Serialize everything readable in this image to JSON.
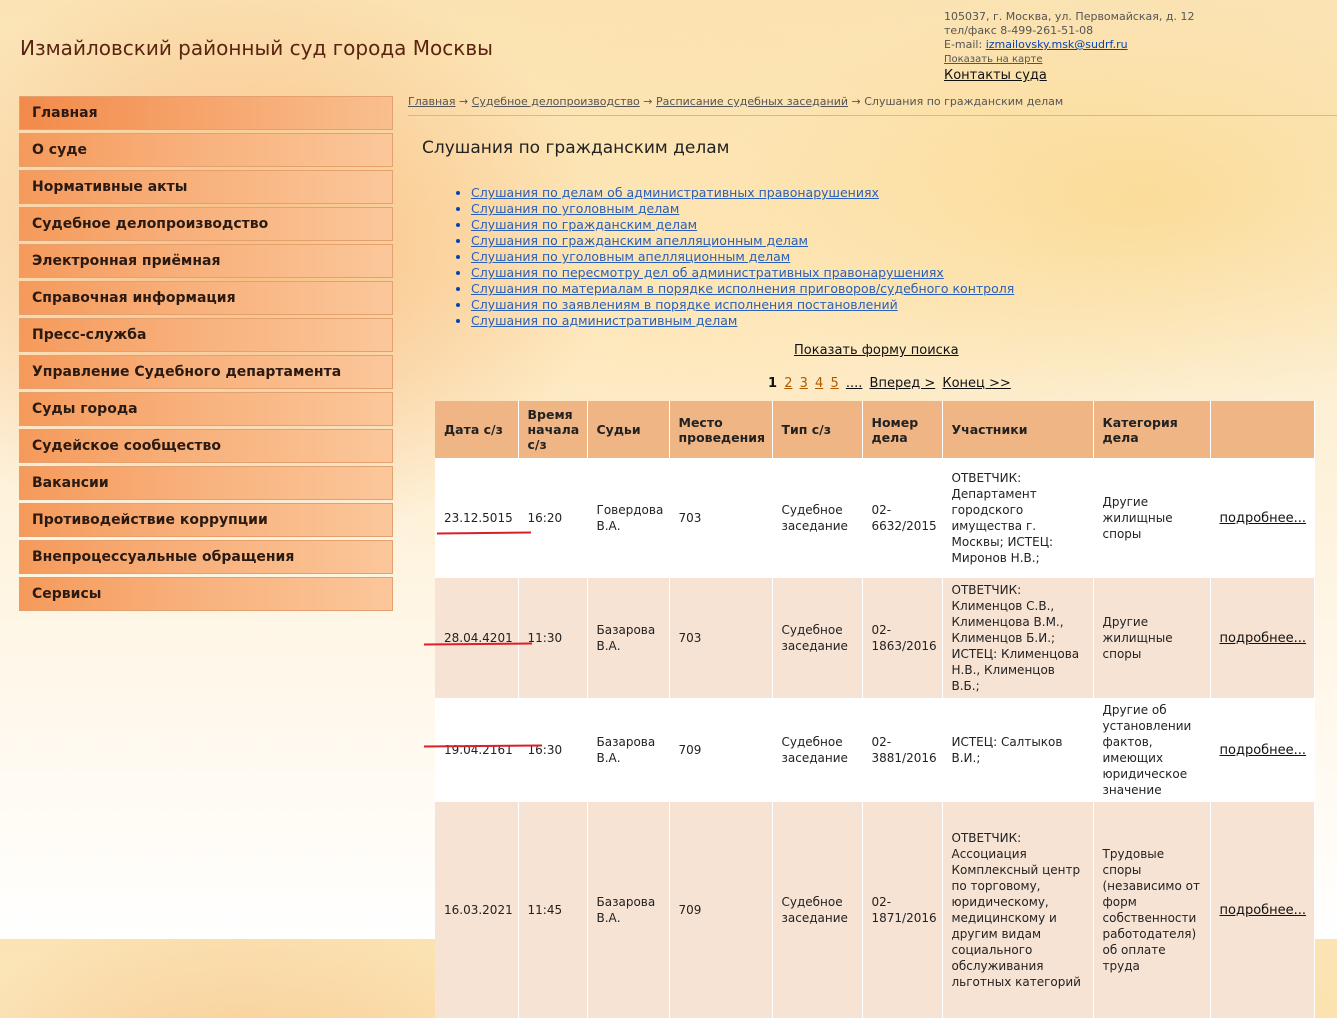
{
  "header": {
    "title": "Измайловский районный суд города Москвы",
    "address": "105037, г. Москва, ул. Первомайская, д. 12",
    "phone": "тел/факс 8-499-261-51-08",
    "email_label": "E-mail:",
    "email": "izmailovsky.msk@sudrf.ru",
    "map_link": "Показать на карте",
    "contacts_link": "Контакты суда"
  },
  "sidebar": {
    "items": [
      {
        "label": "Главная"
      },
      {
        "label": "О суде"
      },
      {
        "label": "Нормативные акты"
      },
      {
        "label": "Судебное делопроизводство"
      },
      {
        "label": "Электронная приёмная"
      },
      {
        "label": "Справочная информация"
      },
      {
        "label": "Пресс-служба"
      },
      {
        "label": "Управление Судебного департамента"
      },
      {
        "label": "Суды города"
      },
      {
        "label": "Судейское сообщество"
      },
      {
        "label": "Вакансии"
      },
      {
        "label": "Противодействие коррупции"
      },
      {
        "label": "Внепроцессуальные обращения"
      },
      {
        "label": "Сервисы"
      }
    ]
  },
  "breadcrumb": {
    "items": [
      "Главная",
      "Судебное делопроизводство",
      "Расписание судебных заседаний"
    ],
    "separator": "→",
    "current": "Слушания по гражданским делам"
  },
  "main": {
    "title": "Слушания по гражданским делам",
    "links": [
      "Слушания по делам об административных правонарушениях",
      "Слушания по уголовным делам",
      "Слушания по гражданским делам",
      "Слушания по гражданским апелляционным делам",
      "Слушания по уголовным апелляционным делам",
      "Слушания по пересмотру дел об административных правонарушениях",
      "Слушания по материалам в порядке исполнения приговоров/судебного контроля",
      "Слушания по заявлениям в порядке исполнения постановлений",
      "Слушания по административным делам"
    ],
    "search_form_link": "Показать форму поиска",
    "pager": {
      "current": "1",
      "pages": [
        "2",
        "3",
        "4",
        "5"
      ],
      "ellipsis": "....",
      "next": "Вперед >",
      "last": "Конец >>"
    }
  },
  "table": {
    "headers": [
      "Дата с/з",
      "Время начала с/з",
      "Судьи",
      "Место проведения",
      "Тип с/з",
      "Номер дела",
      "Участники",
      "Категория дела",
      ""
    ],
    "rows": [
      {
        "date": "23.12.5015",
        "time": "16:20",
        "judge": "Говердова В.А.",
        "place": "703",
        "type": "Судебное заседание",
        "case": "02-6632/2015",
        "participants": "ОТВЕТЧИК: Департамент городского имущества г. Москвы; ИСТЕЦ: Миронов Н.В.;",
        "category": "Другие жилищные споры",
        "more": "подробнее..."
      },
      {
        "date": "28.04.4201",
        "time": "11:30",
        "judge": "Базарова В.А.",
        "place": "703",
        "type": "Судебное заседание",
        "case": "02-1863/2016",
        "participants": "ОТВЕТЧИК: Клименцов С.В., Клименцова В.М., Клименцов Б.И.; ИСТЕЦ: Клименцова Н.В., Клименцов В.Б.;",
        "category": "Другие жилищные споры",
        "more": "подробнее..."
      },
      {
        "date": "19.04.2161",
        "time": "16:30",
        "judge": "Базарова В.А.",
        "place": "709",
        "type": "Судебное заседание",
        "case": "02-3881/2016",
        "participants": "ИСТЕЦ: Салтыков В.И.;",
        "category": "Другие об установлении фактов, имеющих юридическое значение",
        "more": "подробнее..."
      },
      {
        "date": "16.03.2021",
        "time": "11:45",
        "judge": "Базарова В.А.",
        "place": "709",
        "type": "Судебное заседание",
        "case": "02-1871/2016",
        "participants": "ОТВЕТЧИК: Ассоциация Комплексный центр по торговому, юридическому, медицинскому и другим видам социального обслуживания льготных категорий",
        "category": "Трудовые споры (независимо от форм собственности работодателя) об оплате труда",
        "more": "подробнее..."
      }
    ]
  },
  "colors": {
    "annotation_underline": "#d9202a",
    "table_header_bg": "#efb584",
    "nav_item_bg": "#f59a5b"
  }
}
